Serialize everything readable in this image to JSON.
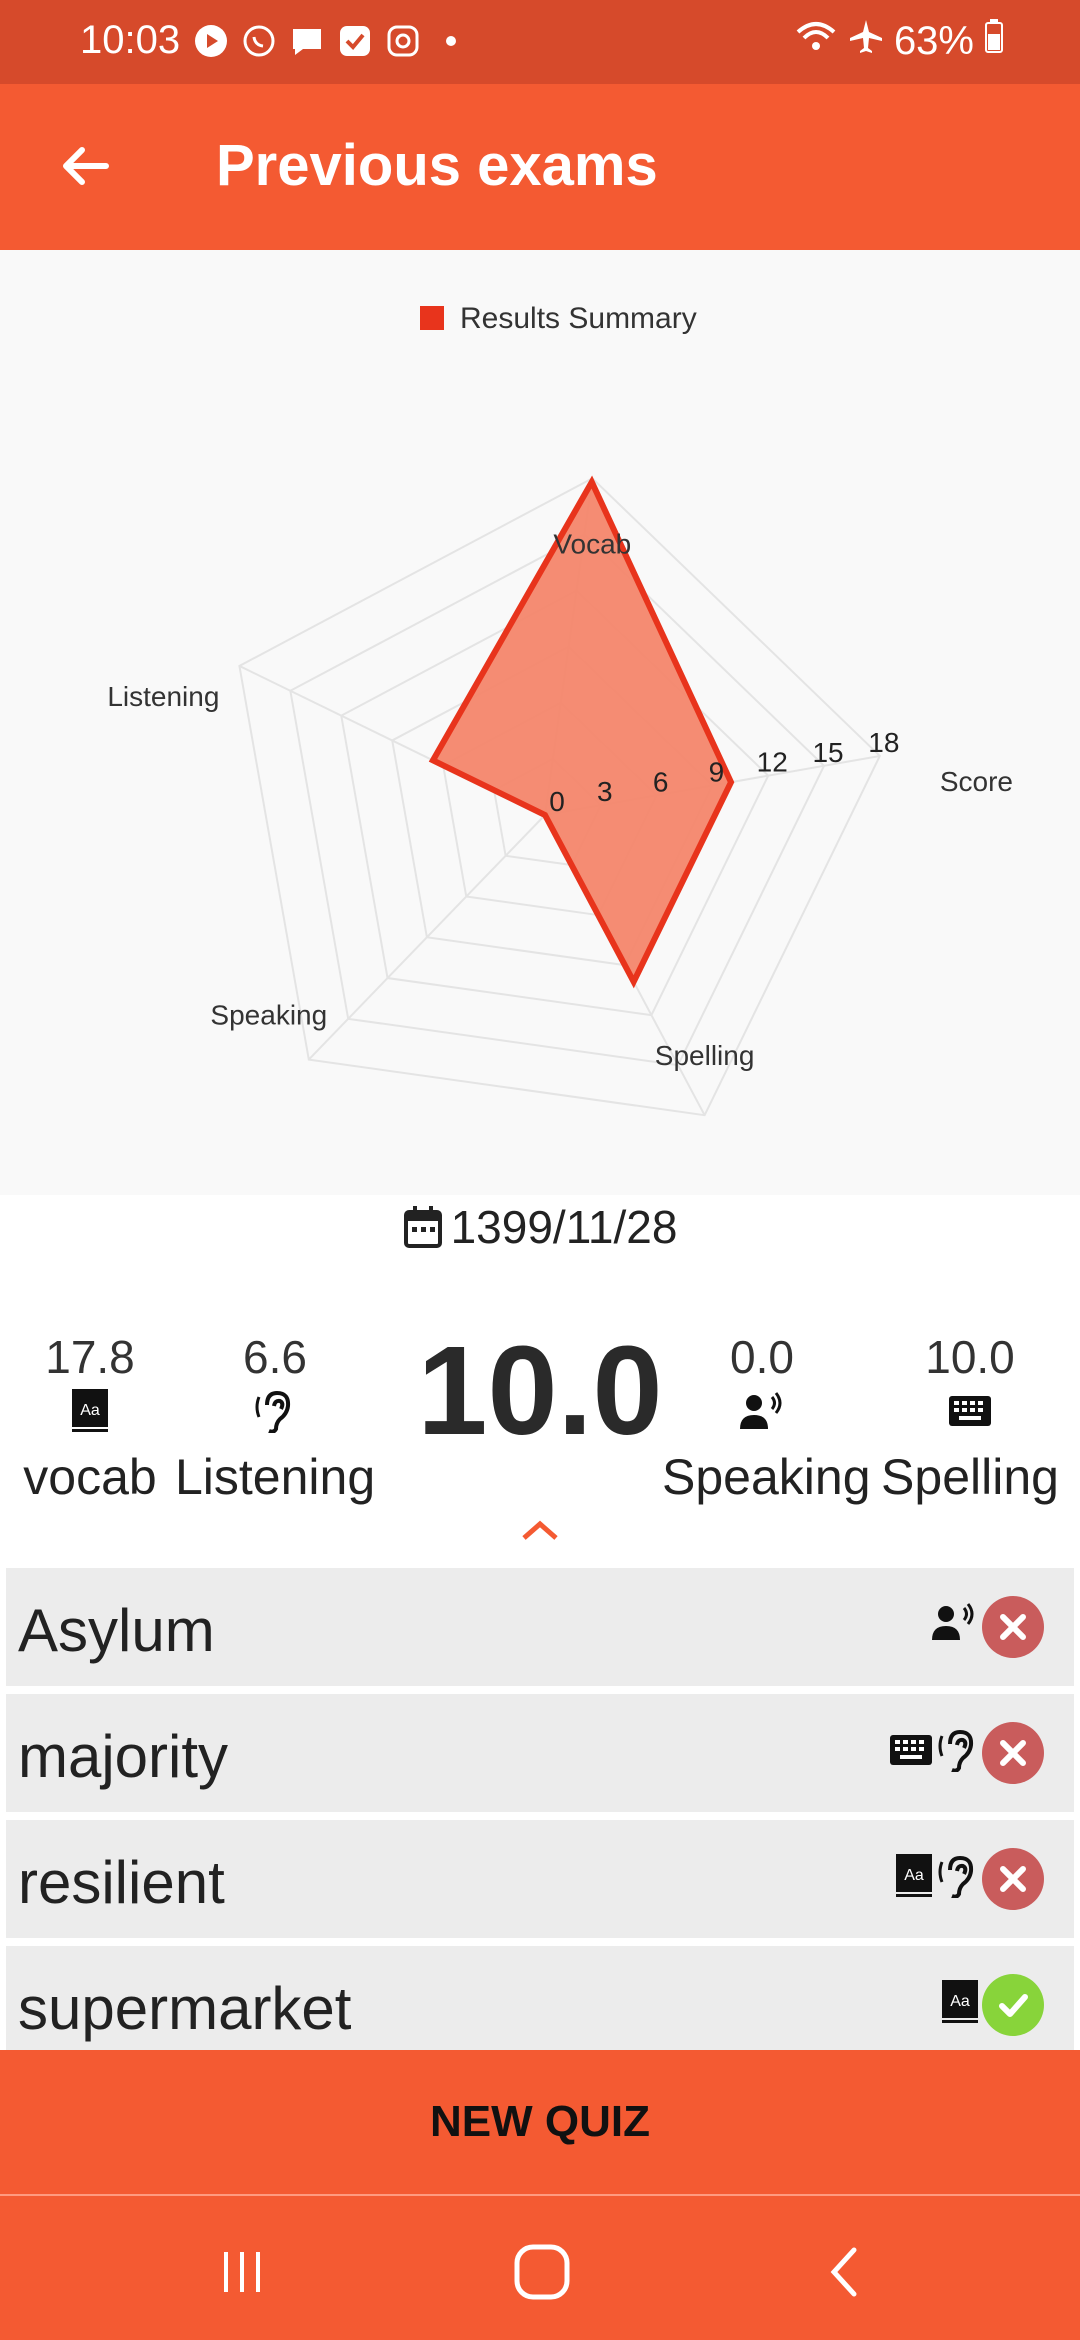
{
  "status_bar": {
    "time": "10:03",
    "battery": "63%",
    "icons": [
      "play-icon",
      "whatsapp-icon",
      "message-icon",
      "check-icon",
      "instagram-icon",
      "dot-icon"
    ],
    "right_icons": [
      "wifi-icon",
      "airplane-icon",
      "battery-icon"
    ]
  },
  "app_bar": {
    "title": "Previous exams",
    "back_icon": "arrow-left-icon"
  },
  "chart_data": {
    "type": "radar",
    "legend": [
      "Results Summary"
    ],
    "legend_placement": "top-center",
    "axes": [
      "Score",
      "Spelling",
      "Speaking",
      "Listening",
      "Vocab"
    ],
    "axis_label_visible": [
      "Score",
      "Spelling",
      "Speaking",
      "Listening",
      "Vocab"
    ],
    "ticks": [
      0,
      3,
      6,
      9,
      12,
      15,
      18
    ],
    "range": [
      0,
      18
    ],
    "series": [
      {
        "name": "Results Summary",
        "values": [
          10.0,
          10.0,
          0.0,
          6.6,
          17.8
        ],
        "color": "#e8341c"
      }
    ]
  },
  "summary": {
    "date": "1399/11/28",
    "total": "10.0",
    "scores": [
      {
        "value": "17.8",
        "label": "vocab",
        "icon": "book-icon"
      },
      {
        "value": "6.6",
        "label": "Listening",
        "icon": "ear-icon"
      },
      {
        "value": "0.0",
        "label": "Speaking",
        "icon": "speaking-icon"
      },
      {
        "value": "10.0",
        "label": "Spelling",
        "icon": "keyboard-icon"
      }
    ]
  },
  "words": [
    {
      "word": "Asylum",
      "icons": [
        "speaking-icon"
      ],
      "status": "wrong"
    },
    {
      "word": "majority",
      "icons": [
        "keyboard-icon",
        "ear-icon"
      ],
      "status": "wrong"
    },
    {
      "word": "resilient",
      "icons": [
        "book-icon",
        "ear-icon"
      ],
      "status": "wrong"
    },
    {
      "word": "supermarket",
      "icons": [
        "book-icon"
      ],
      "status": "correct"
    }
  ],
  "new_quiz_label": "NEW QUIZ",
  "colors": {
    "primary": "#f45a32",
    "status_bar": "#d64a2b",
    "chart_fill": "#f4866b",
    "chart_stroke": "#e8341c",
    "wrong": "#c95c5c",
    "correct": "#88d43a"
  }
}
